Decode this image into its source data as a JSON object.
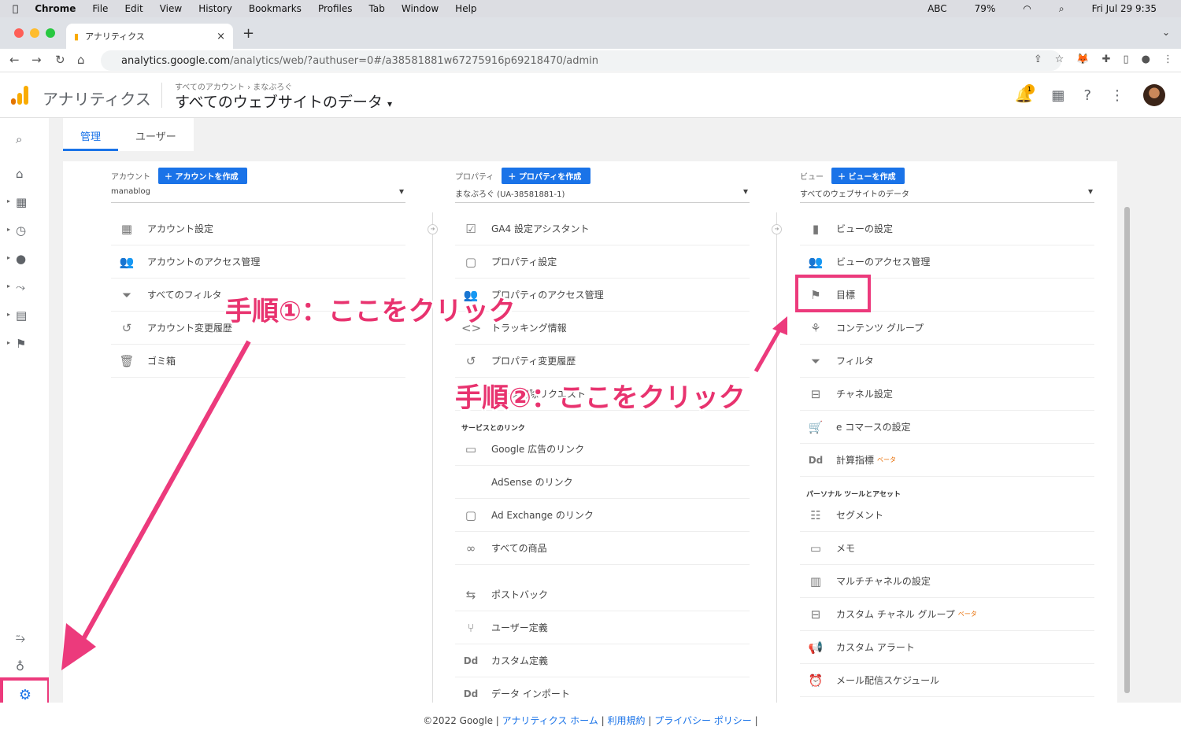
{
  "macmenu": {
    "app": "Chrome",
    "items": [
      "File",
      "Edit",
      "View",
      "History",
      "Bookmarks",
      "Profiles",
      "Tab",
      "Window",
      "Help"
    ],
    "input": "ABC",
    "battery": "79%",
    "clock": "Fri Jul 29  9:35"
  },
  "tab": {
    "title": "アナリティクス"
  },
  "url": {
    "host": "analytics.google.com",
    "path": "/analytics/web/?authuser=0#/a38581881w67275916p69218470/admin"
  },
  "header": {
    "product": "アナリティクス",
    "crumb1": "すべてのアカウント",
    "crumb_sep": "›",
    "crumb2": "まなぶろぐ",
    "view": "すべてのウェブサイトのデータ",
    "notif_count": "1"
  },
  "admin_tabs": [
    "管理",
    "ユーザー"
  ],
  "account": {
    "label": "アカウント",
    "create": "アカウントを作成",
    "selected": "manablog",
    "items": [
      {
        "icon": "▦",
        "label": "アカウント設定"
      },
      {
        "icon": "👥",
        "label": "アカウントのアクセス管理"
      },
      {
        "icon": "⏷",
        "label": "すべてのフィルタ"
      },
      {
        "icon": "↺",
        "label": "アカウント変更履歴"
      },
      {
        "icon": "🗑",
        "label": "ゴミ箱"
      }
    ]
  },
  "property": {
    "label": "プロパティ",
    "create": "プロパティを作成",
    "selected": "まなぶろぐ (UA-38581881-1)",
    "items": [
      {
        "icon": "☑",
        "label": "GA4 設定アシスタント"
      },
      {
        "icon": "▢",
        "label": "プロパティ設定"
      },
      {
        "icon": "👥",
        "label": "プロパティのアクセス管理"
      },
      {
        "icon": "<>",
        "label": "トラッキング情報"
      },
      {
        "icon": "↺",
        "label": "プロパティ変更履歴"
      },
      {
        "icon": "⇪",
        "label": "データ削除リクエスト"
      }
    ],
    "section": "サービスとのリンク",
    "items2": [
      {
        "icon": "▭",
        "label": "Google 広告のリンク"
      },
      {
        "icon": "",
        "label": "AdSense のリンク"
      },
      {
        "icon": "▢",
        "label": "Ad Exchange のリンク"
      },
      {
        "icon": "∞",
        "label": "すべての商品"
      }
    ],
    "items3": [
      {
        "icon": "⇆",
        "label": "ポストバック"
      },
      {
        "icon": "⑂",
        "label": "ユーザー定義"
      },
      {
        "icon": "Dd",
        "label": "カスタム定義"
      },
      {
        "icon": "Dd",
        "label": "データ インポート"
      }
    ]
  },
  "view": {
    "label": "ビュー",
    "create": "ビューを作成",
    "selected": "すべてのウェブサイトのデータ",
    "items": [
      {
        "icon": "▮",
        "label": "ビューの設定"
      },
      {
        "icon": "👥",
        "label": "ビューのアクセス管理"
      },
      {
        "icon": "⚑",
        "label": "目標"
      },
      {
        "icon": "⚘",
        "label": "コンテンツ グループ"
      },
      {
        "icon": "⏷",
        "label": "フィルタ"
      },
      {
        "icon": "⊟",
        "label": "チャネル設定"
      },
      {
        "icon": "🛒",
        "label": "e コマースの設定"
      },
      {
        "icon": "Dd",
        "label": "計算指標",
        "beta": "ベータ"
      }
    ],
    "section": "パーソナル ツールとアセット",
    "items2": [
      {
        "icon": "☷",
        "label": "セグメント"
      },
      {
        "icon": "▭",
        "label": "メモ"
      },
      {
        "icon": "▥",
        "label": "マルチチャネルの設定"
      },
      {
        "icon": "⊟",
        "label": "カスタム チャネル グループ",
        "beta": "ベータ"
      },
      {
        "icon": "📢",
        "label": "カスタム アラート"
      },
      {
        "icon": "⏰",
        "label": "メール配信スケジュール"
      }
    ]
  },
  "annotations": {
    "step1": "手順①：ここをクリック",
    "step2": "手順②：ここをクリック"
  },
  "footer": {
    "copyright": "©2022 Google",
    "sep": "|",
    "home": "アナリティクス ホーム",
    "terms": "利用規約",
    "privacy": "プライバシー ポリシー"
  },
  "colors": {
    "accent": "#1a73e8",
    "highlight": "#ec3a7c"
  }
}
